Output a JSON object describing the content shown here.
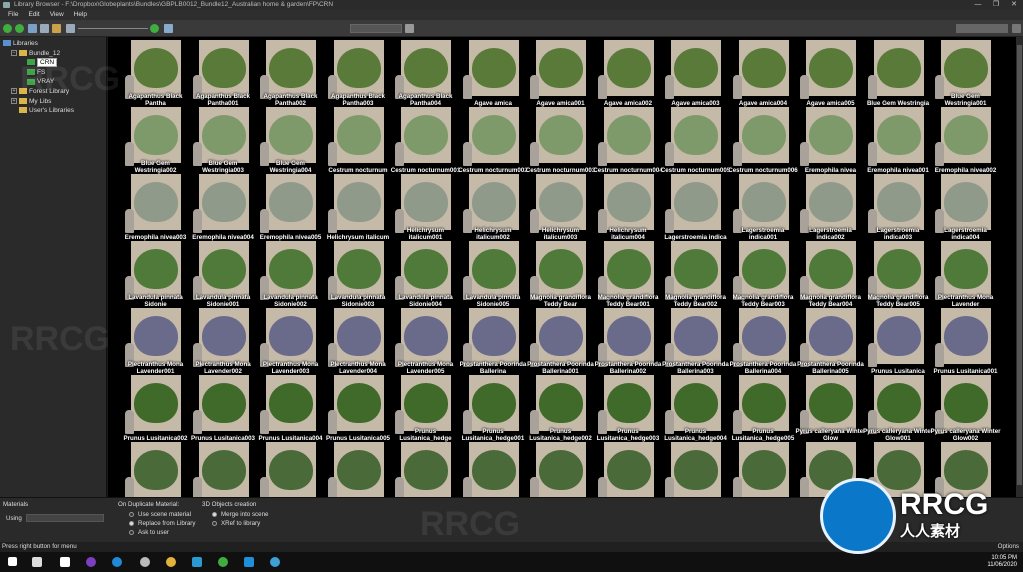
{
  "window": {
    "title": "Library Browser - F:\\Dropbox\\Globeplants\\Bundles\\GBPLB0012_Bundle12_Australian home & garden\\FP\\CRN",
    "controls": [
      "—",
      "❐",
      "✕"
    ]
  },
  "menu": [
    "File",
    "Edit",
    "View",
    "Help"
  ],
  "tree": {
    "items": [
      {
        "label": "Libraries",
        "level": 0,
        "expander": "",
        "kind": "lib"
      },
      {
        "label": "Bundle_12",
        "level": 1,
        "expander": "−",
        "kind": "folder"
      },
      {
        "label": "CRN",
        "level": 2,
        "expander": "",
        "kind": "green",
        "selected": true
      },
      {
        "label": "FS",
        "level": 2,
        "expander": "",
        "kind": "green"
      },
      {
        "label": "VRAY",
        "level": 2,
        "expander": "",
        "kind": "green"
      },
      {
        "label": "Forest Library",
        "level": 1,
        "expander": "+",
        "kind": "folder"
      },
      {
        "label": "My Libs",
        "level": 1,
        "expander": "+",
        "kind": "folder"
      },
      {
        "label": "User's Libraries",
        "level": 1,
        "expander": "",
        "kind": "folder"
      }
    ]
  },
  "grid": {
    "rows": [
      [
        "Agapanthus Black Pantha",
        "Agapanthus Black Pantha001",
        "Agapanthus Black Pantha002",
        "Agapanthus Black Pantha003",
        "Agapanthus Black Pantha004",
        "Agave amica",
        "Agave amica001",
        "Agave amica002",
        "Agave amica003",
        "Agave amica004",
        "Agave amica005",
        "Blue Gem Westringia",
        "Blue Gem Westringia001"
      ],
      [
        "Blue Gem Westringia002",
        "Blue Gem Westringia003",
        "Blue Gem Westringia004",
        "Cestrum nocturnum",
        "Cestrum nocturnum001",
        "Cestrum nocturnum002",
        "Cestrum nocturnum003",
        "Cestrum nocturnum004",
        "Cestrum nocturnum005",
        "Cestrum nocturnum006",
        "Eremophila nivea",
        "Eremophila nivea001",
        "Eremophila nivea002"
      ],
      [
        "Eremophila nivea003",
        "Eremophila nivea004",
        "Eremophila nivea005",
        "Helichrysum italicum",
        "Helichrysum italicum001",
        "Helichrysum italicum002",
        "Helichrysum italicum003",
        "Helichrysum italicum004",
        "Lagerstroemia indica",
        "Lagerstroemia indica001",
        "Lagerstroemia indica002",
        "Lagerstroemia indica003",
        "Lagerstroemia indica004"
      ],
      [
        "Lavandula pinnata Sidonie",
        "Lavandula pinnata Sidonie001",
        "Lavandula pinnata Sidonie002",
        "Lavandula pinnata Sidonie003",
        "Lavandula pinnata Sidonie004",
        "Lavandula pinnata Sidonie005",
        "Magnolia grandiflora Teddy Bear",
        "Magnolia grandiflora Teddy Bear001",
        "Magnolia grandiflora Teddy Bear002",
        "Magnolia grandiflora Teddy Bear003",
        "Magnolia grandiflora Teddy Bear004",
        "Magnolia grandiflora Teddy Bear005",
        "Plectranthus Mona Lavender"
      ],
      [
        "Plectranthus Mona Lavender001",
        "Plectranthus Mona Lavender002",
        "Plectranthus Mona Lavender003",
        "Plectranthus Mona Lavender004",
        "Plectranthus Mona Lavender005",
        "Prostanthera Poorinda Ballerina",
        "Prostanthera Poorinda Ballerina001",
        "Prostanthera Poorinda Ballerina002",
        "Prostanthera Poorinda Ballerina003",
        "Prostanthera Poorinda Ballerina004",
        "Prostanthera Poorinda Ballerina005",
        "Prunus Lusitanica",
        "Prunus Lusitanica001"
      ],
      [
        "Prunus Lusitanica002",
        "Prunus Lusitanica003",
        "Prunus Lusitanica004",
        "Prunus Lusitanica005",
        "Prunus Lusitanica_hedge",
        "Prunus Lusitanica_hedge001",
        "Prunus Lusitanica_hedge002",
        "Prunus Lusitanica_hedge003",
        "Prunus Lusitanica_hedge004",
        "Prunus Lusitanica_hedge005",
        "Pyrus calleryana Winter Glow",
        "Pyrus calleryana Winter Glow001",
        "Pyrus calleryana Winter Glow002"
      ],
      [
        "",
        "",
        "",
        "",
        "",
        "",
        "",
        "",
        "",
        "",
        "",
        "",
        ""
      ]
    ],
    "row_colors": [
      "#5a7a3a",
      "#7f9a6a",
      "#8f9a8a",
      "#4f7a3a",
      "#6a6a8a",
      "#3f6a2a",
      "#4a6a3a"
    ]
  },
  "options": {
    "materials_title": "Materials",
    "using_label": "Using",
    "using_value": "",
    "duplicate_title": "On Duplicate Material:",
    "duplicate_options": [
      "Use scene material",
      "Replace from Library",
      "Ask to user"
    ],
    "duplicate_selected": 1,
    "creation_title": "3D Objects creation",
    "creation_options": [
      "Merge into scene",
      "XRef to library"
    ],
    "creation_selected": 0
  },
  "status": {
    "left": "Press right button for menu",
    "right": "Options"
  },
  "taskbar": {
    "time": "10:05 PM",
    "date": "11/06/2020"
  },
  "watermark": {
    "brand": "RRCG",
    "sub": "人人素材"
  }
}
